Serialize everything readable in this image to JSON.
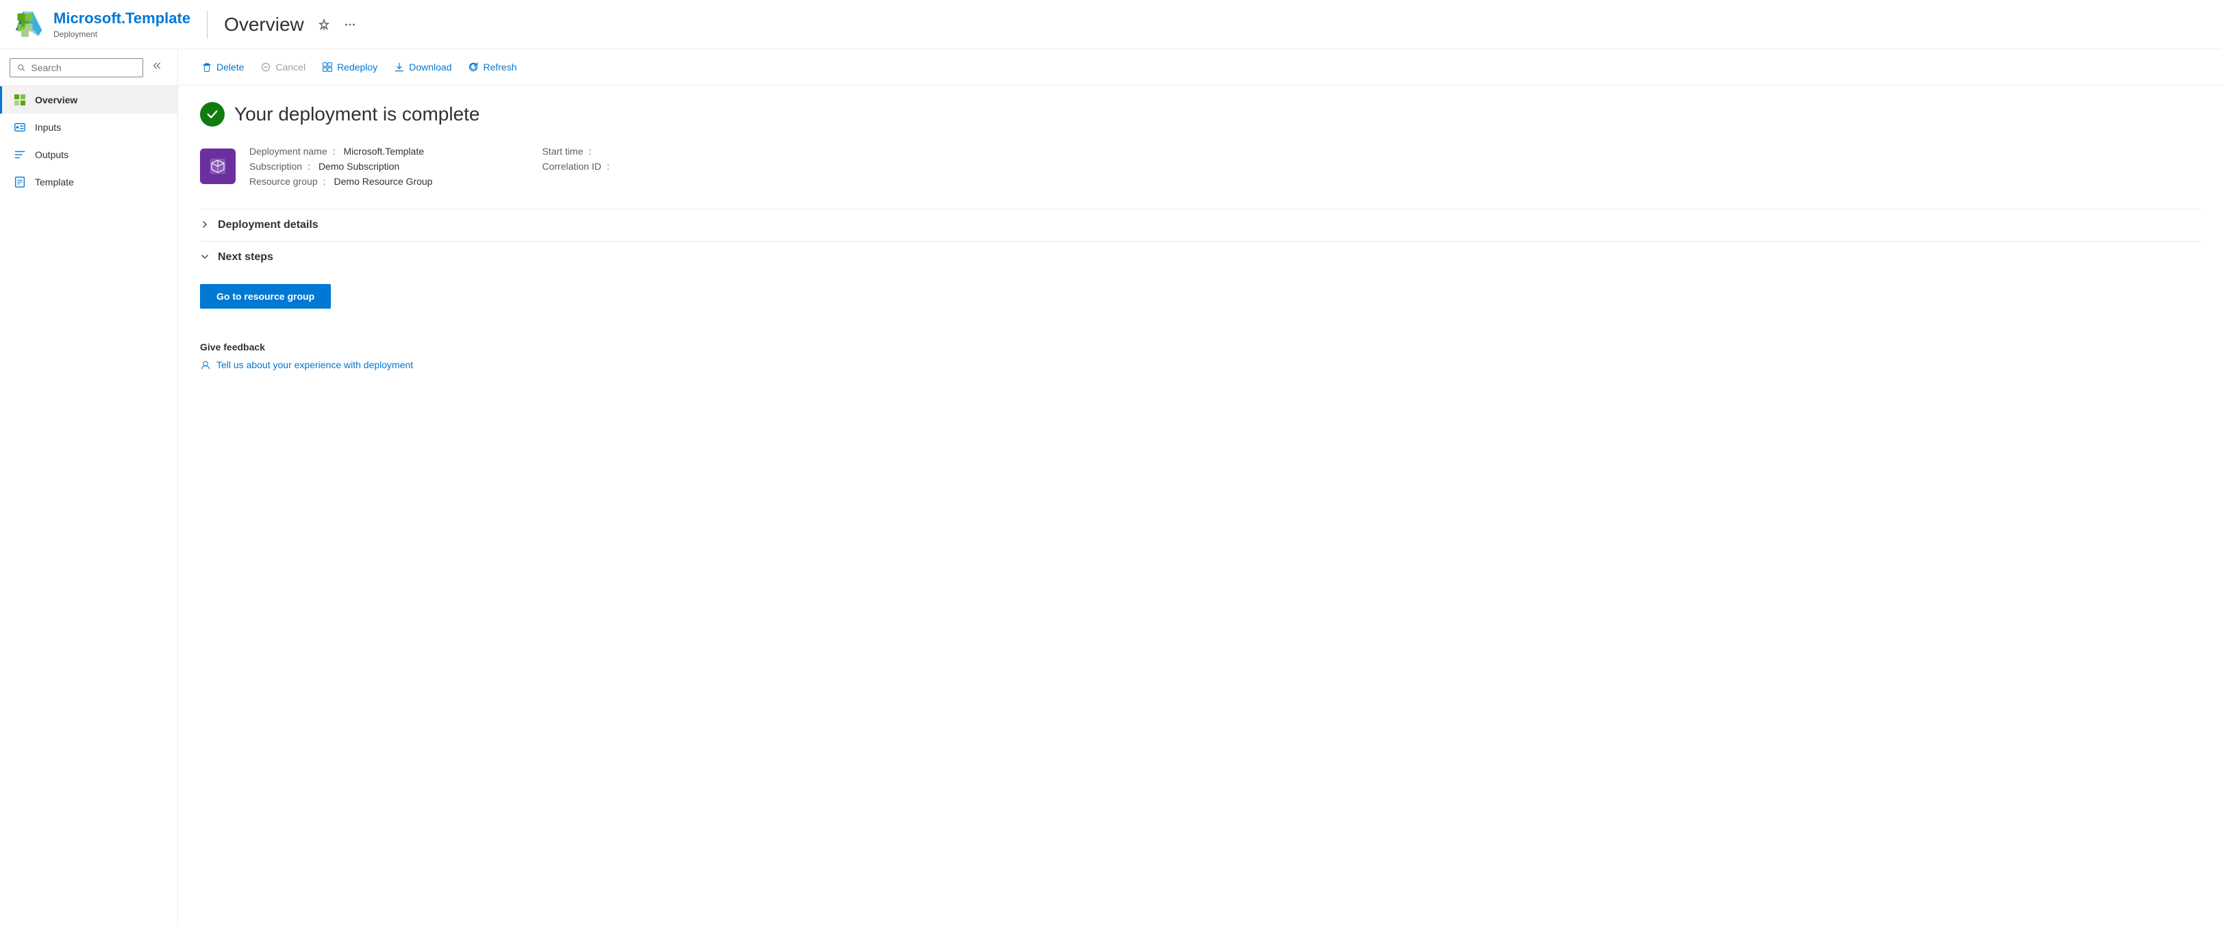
{
  "header": {
    "logo_alt": "Microsoft Azure",
    "title": "Microsoft.Template",
    "subtitle": "Deployment",
    "divider": true,
    "page_title": "Overview",
    "pin_label": "Pin",
    "more_label": "More options"
  },
  "sidebar": {
    "search_placeholder": "Search",
    "collapse_label": "Collapse",
    "nav_items": [
      {
        "id": "overview",
        "label": "Overview",
        "icon": "overview-icon",
        "active": true
      },
      {
        "id": "inputs",
        "label": "Inputs",
        "icon": "inputs-icon",
        "active": false
      },
      {
        "id": "outputs",
        "label": "Outputs",
        "icon": "outputs-icon",
        "active": false
      },
      {
        "id": "template",
        "label": "Template",
        "icon": "template-icon",
        "active": false
      }
    ]
  },
  "toolbar": {
    "delete_label": "Delete",
    "cancel_label": "Cancel",
    "redeploy_label": "Redeploy",
    "download_label": "Download",
    "refresh_label": "Refresh"
  },
  "overview": {
    "status_title": "Your deployment is complete",
    "deployment": {
      "name_label": "Deployment name",
      "name_value": "Microsoft.Template",
      "subscription_label": "Subscription",
      "subscription_value": "Demo Subscription",
      "resource_group_label": "Resource group",
      "resource_group_value": "Demo Resource Group",
      "start_time_label": "Start time",
      "start_time_value": "",
      "correlation_label": "Correlation ID",
      "correlation_value": ""
    },
    "sections": [
      {
        "id": "deployment-details",
        "label": "Deployment details",
        "expanded": false,
        "chevron": ">"
      },
      {
        "id": "next-steps",
        "label": "Next steps",
        "expanded": true,
        "chevron": "v"
      }
    ],
    "go_to_resource_group_label": "Go to resource group",
    "feedback": {
      "title": "Give feedback",
      "link_label": "Tell us about your experience with deployment"
    }
  }
}
